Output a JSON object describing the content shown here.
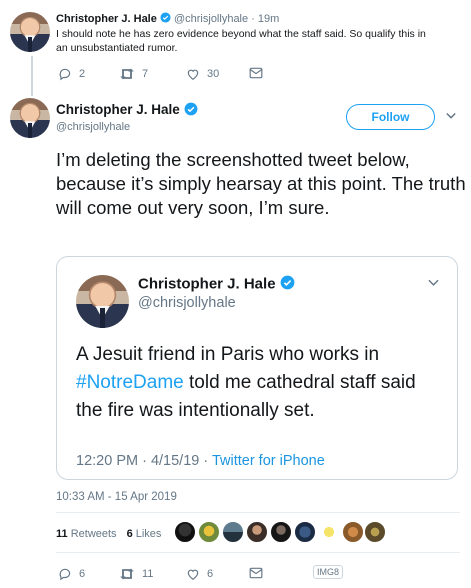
{
  "reply_tweet": {
    "author_name": "Christopher J. Hale",
    "author_handle": "@chrisjollyhale",
    "age": "· 19m",
    "text_line1": "I should note he has zero evidence beyond what the staff said. So qualify this in",
    "text_line2": "an unsubstantiated rumor.",
    "reply_count": "2",
    "retweet_count": "7",
    "like_count": "30"
  },
  "main_tweet": {
    "author_name": "Christopher J. Hale",
    "author_handle": "@chrisjollyhale",
    "follow_label": "Follow",
    "text": "I’m deleting the screenshotted tweet below, because it’s simply hearsay at this point. The truth will come out very soon, I’m sure.",
    "timestamp": "10:33 AM - 15 Apr 2019",
    "retweets_count": "11",
    "retweets_label": "Retweets",
    "likes_count": "6",
    "likes_label": "Likes",
    "reply_count": "6",
    "retweet_count": "11",
    "like_count": "6"
  },
  "quoted_tweet": {
    "author_name": "Christopher J. Hale",
    "author_handle": "@chrisjollyhale",
    "text_before": "A Jesuit friend in Paris who works in ",
    "hashtag": "#NotreDame",
    "text_after": " told me cathedral staff said the fire was intentionally set.",
    "time": "12:20 PM · 4/15/19 · ",
    "source": "Twitter for iPhone"
  },
  "image_badge": "IMG8",
  "colors": {
    "accent": "#1da1f2",
    "verified": "#1da1f2",
    "muted": "#657786",
    "border": "#ccd6dd"
  }
}
